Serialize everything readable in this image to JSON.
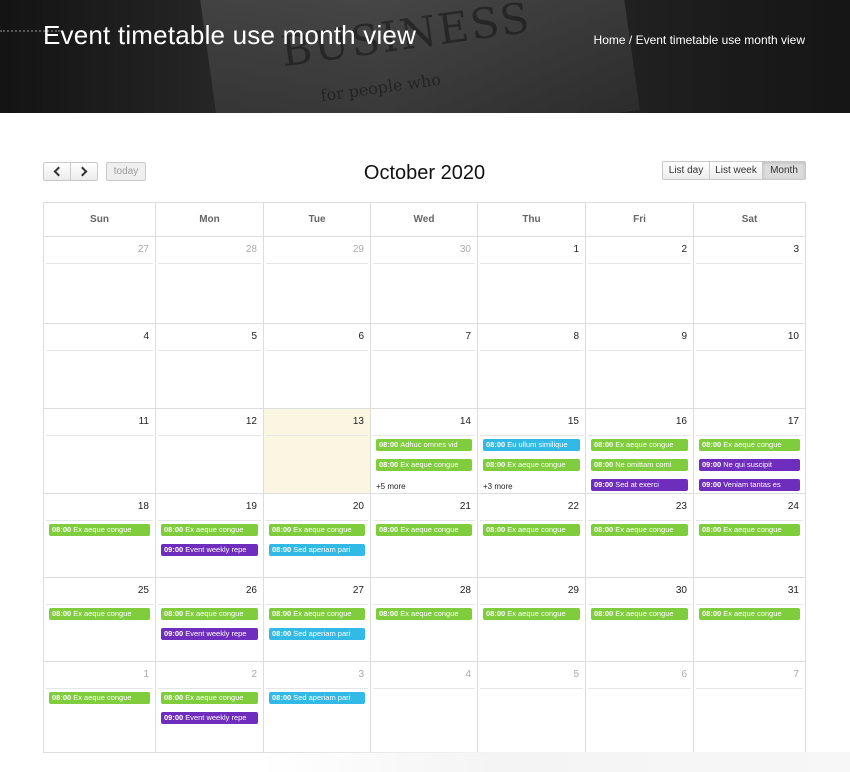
{
  "hero": {
    "title": "Event timetable use month view",
    "breadcrumb": {
      "home": "Home",
      "separator": "/",
      "current": "Event timetable use month view"
    },
    "background_words": {
      "headline": "BUSINESS",
      "subline": "for people who"
    }
  },
  "toolbar": {
    "prev_icon": "chevron-left-icon",
    "next_icon": "chevron-right-icon",
    "today_label": "today",
    "title": "October 2020",
    "views": [
      {
        "label": "List day",
        "active": false
      },
      {
        "label": "List week",
        "active": false
      },
      {
        "label": "Month",
        "active": true
      }
    ]
  },
  "calendar": {
    "day_headers": [
      "Sun",
      "Mon",
      "Tue",
      "Wed",
      "Thu",
      "Fri",
      "Sat"
    ],
    "colors": {
      "green": "#7fcc3c",
      "purple": "#6f2dbd",
      "blue": "#33b9e6",
      "today_bg": "#fbf6e2"
    },
    "weeks": [
      {
        "days": [
          {
            "num": "27",
            "other": true,
            "events": []
          },
          {
            "num": "28",
            "other": true,
            "events": []
          },
          {
            "num": "29",
            "other": true,
            "events": []
          },
          {
            "num": "30",
            "other": true,
            "events": []
          },
          {
            "num": "1",
            "events": []
          },
          {
            "num": "2",
            "events": []
          },
          {
            "num": "3",
            "events": []
          }
        ]
      },
      {
        "days": [
          {
            "num": "4",
            "events": []
          },
          {
            "num": "5",
            "events": []
          },
          {
            "num": "6",
            "events": []
          },
          {
            "num": "7",
            "events": []
          },
          {
            "num": "8",
            "events": []
          },
          {
            "num": "9",
            "events": []
          },
          {
            "num": "10",
            "events": []
          }
        ]
      },
      {
        "days": [
          {
            "num": "11",
            "events": []
          },
          {
            "num": "12",
            "events": []
          },
          {
            "num": "13",
            "today": true,
            "events": []
          },
          {
            "num": "14",
            "events": [
              {
                "time": "08:00",
                "title": "Adhuc omnes vid",
                "color": "green"
              },
              {
                "time": "08:00",
                "title": "Ex aeque congue",
                "color": "green"
              }
            ],
            "more": "+5 more"
          },
          {
            "num": "15",
            "events": [
              {
                "time": "08:00",
                "title": "Eu ullum similique",
                "color": "blue"
              },
              {
                "time": "08:00",
                "title": "Ex aeque congue",
                "color": "green"
              }
            ],
            "more": "+3 more"
          },
          {
            "num": "16",
            "events": [
              {
                "time": "08:00",
                "title": "Ex aeque congue",
                "color": "green"
              },
              {
                "time": "08:00",
                "title": "Ne omittam comi",
                "color": "green"
              },
              {
                "time": "09:00",
                "title": "Sed at exerci",
                "color": "purple"
              }
            ]
          },
          {
            "num": "17",
            "events": [
              {
                "time": "08:00",
                "title": "Ex aeque congue",
                "color": "green"
              },
              {
                "time": "09:00",
                "title": "Ne qui suscipit",
                "color": "purple"
              },
              {
                "time": "09:00",
                "title": "Veniam tantas es",
                "color": "purple"
              }
            ]
          }
        ]
      },
      {
        "days": [
          {
            "num": "18",
            "events": [
              {
                "time": "08:00",
                "title": "Ex aeque congue",
                "color": "green"
              }
            ]
          },
          {
            "num": "19",
            "events": [
              {
                "time": "08:00",
                "title": "Ex aeque congue",
                "color": "green"
              },
              {
                "time": "09:00",
                "title": "Event weekly repe",
                "color": "purple"
              }
            ]
          },
          {
            "num": "20",
            "events": [
              {
                "time": "08:00",
                "title": "Ex aeque congue",
                "color": "green"
              },
              {
                "time": "08:00",
                "title": "Sed aperiam pari",
                "color": "blue"
              }
            ]
          },
          {
            "num": "21",
            "events": [
              {
                "time": "08:00",
                "title": "Ex aeque congue",
                "color": "green"
              }
            ]
          },
          {
            "num": "22",
            "events": [
              {
                "time": "08:00",
                "title": "Ex aeque congue",
                "color": "green"
              }
            ]
          },
          {
            "num": "23",
            "events": [
              {
                "time": "08:00",
                "title": "Ex aeque congue",
                "color": "green"
              }
            ]
          },
          {
            "num": "24",
            "events": [
              {
                "time": "08:00",
                "title": "Ex aeque congue",
                "color": "green"
              }
            ]
          }
        ]
      },
      {
        "days": [
          {
            "num": "25",
            "events": [
              {
                "time": "08:00",
                "title": "Ex aeque congue",
                "color": "green"
              }
            ]
          },
          {
            "num": "26",
            "events": [
              {
                "time": "08:00",
                "title": "Ex aeque congue",
                "color": "green"
              },
              {
                "time": "09:00",
                "title": "Event weekly repe",
                "color": "purple"
              }
            ]
          },
          {
            "num": "27",
            "events": [
              {
                "time": "08:00",
                "title": "Ex aeque congue",
                "color": "green"
              },
              {
                "time": "08:00",
                "title": "Sed aperiam pari",
                "color": "blue"
              }
            ]
          },
          {
            "num": "28",
            "events": [
              {
                "time": "08:00",
                "title": "Ex aeque congue",
                "color": "green"
              }
            ]
          },
          {
            "num": "29",
            "events": [
              {
                "time": "08:00",
                "title": "Ex aeque congue",
                "color": "green"
              }
            ]
          },
          {
            "num": "30",
            "events": [
              {
                "time": "08:00",
                "title": "Ex aeque congue",
                "color": "green"
              }
            ]
          },
          {
            "num": "31",
            "events": [
              {
                "time": "08:00",
                "title": "Ex aeque congue",
                "color": "green"
              }
            ]
          }
        ]
      },
      {
        "days": [
          {
            "num": "1",
            "other": true,
            "events": [
              {
                "time": "08:00",
                "title": "Ex aeque congue",
                "color": "green"
              }
            ]
          },
          {
            "num": "2",
            "other": true,
            "events": [
              {
                "time": "08:00",
                "title": "Ex aeque congue",
                "color": "green"
              },
              {
                "time": "09:00",
                "title": "Event weekly repe",
                "color": "purple"
              }
            ]
          },
          {
            "num": "3",
            "other": true,
            "events": [
              {
                "time": "08:00",
                "title": "Sed aperiam pari",
                "color": "blue"
              }
            ]
          },
          {
            "num": "4",
            "other": true,
            "events": []
          },
          {
            "num": "5",
            "other": true,
            "events": []
          },
          {
            "num": "6",
            "other": true,
            "events": []
          },
          {
            "num": "7",
            "other": true,
            "events": []
          }
        ]
      }
    ]
  }
}
